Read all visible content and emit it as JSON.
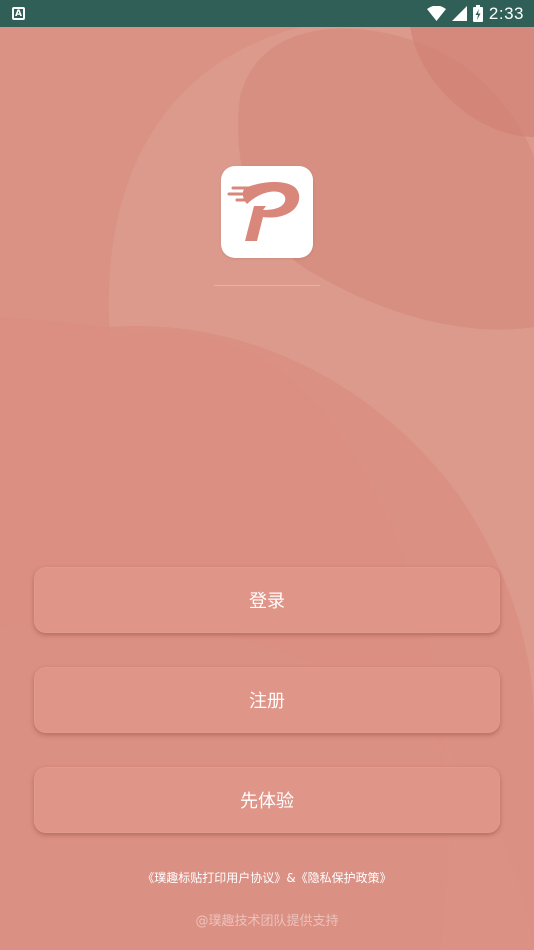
{
  "status_bar": {
    "notification_icon": "A",
    "time": "2:33",
    "icons": [
      "wifi-icon",
      "signal-icon",
      "battery-icon"
    ]
  },
  "colors": {
    "status_bar": "#2f5f57",
    "background": "#d98d80",
    "button": "#df9588",
    "text": "#ffffff"
  },
  "buttons": {
    "login": "登录",
    "register": "注册",
    "trial": "先体验"
  },
  "footer": {
    "user_agreement": "《璞趣标贴打印用户协议》",
    "connector": "&",
    "privacy_policy": "《隐私保护政策》",
    "support": "@璞趣技术团队提供支持"
  }
}
